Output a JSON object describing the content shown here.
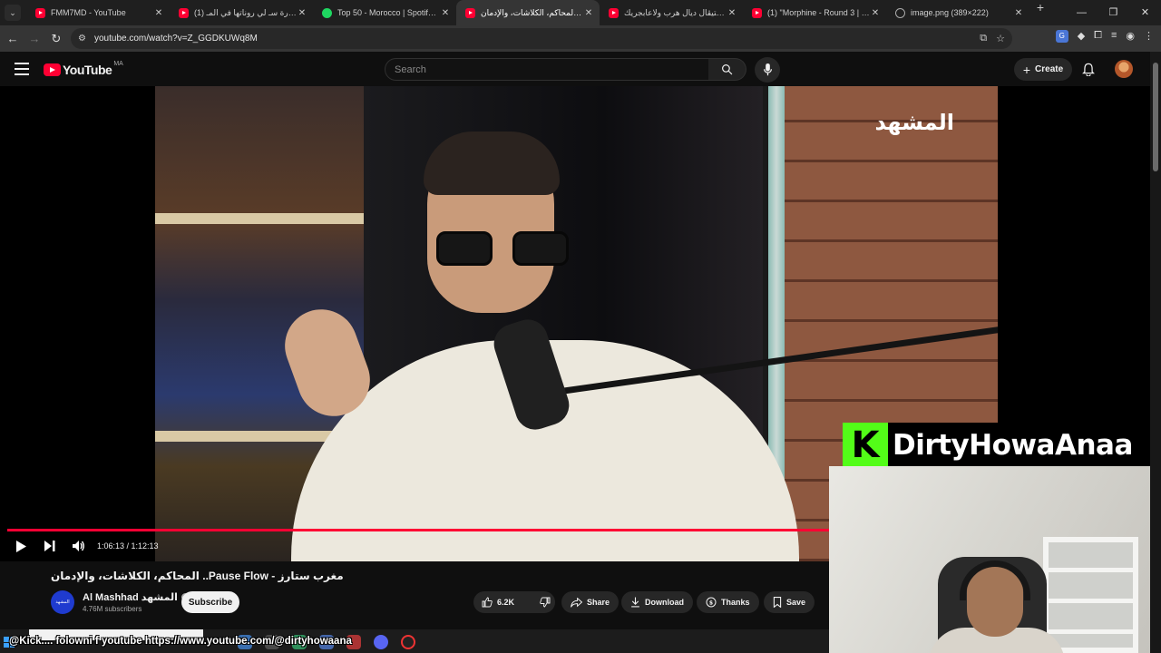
{
  "browser": {
    "tabs": [
      {
        "title": "FMM7MD - YouTube",
        "favicon": "youtube-icon",
        "active": false
      },
      {
        "title": "(1) السيارة سـ لي روناتها في المـ",
        "favicon": "youtube-icon",
        "active": false
      },
      {
        "title": "Top 50 - Morocco | Spotify Play",
        "favicon": "spotify-icon",
        "active": false
      },
      {
        "title": "المحاكم، الكلاشات، والإدمان Flow",
        "favicon": "youtube-icon",
        "active": true
      },
      {
        "title": "فيستيڤال ديال هرب ولاعابجريك",
        "favicon": "youtube-icon",
        "active": false
      },
      {
        "title": "(1) \"Morphine - Round 3 | Figh",
        "favicon": "youtube-icon",
        "active": false
      },
      {
        "title": "image.png (389×222)",
        "favicon": "image-icon",
        "active": false
      }
    ],
    "new_tab": "+",
    "window_controls": {
      "minimize": "—",
      "restore": "❐",
      "close": "✕"
    },
    "url": "youtube.com/watch?v=Z_GGDKUWq8M"
  },
  "youtube": {
    "logo_text": "YouTube",
    "country_code": "MA",
    "search_placeholder": "Search",
    "create_label": "Create",
    "video": {
      "watermark": "المشهد",
      "current_time": "1:06:13",
      "duration": "1:12:13",
      "time_display": "1:06:13 / 1:12:13",
      "progress_fraction": 0.917
    },
    "title": "مغرب ستارز - Pause Flow.. المحاكم، الكلاشات، والإدمان",
    "channel": {
      "name": "Al Mashhad المشهد",
      "avatar_text": "المشهد",
      "subscribers": "4.76M subscribers",
      "subscribe_label": "Subscribe"
    },
    "actions": {
      "likes": "6.2K",
      "share": "Share",
      "download": "Download",
      "thanks": "Thanks",
      "save": "Save"
    }
  },
  "stream_overlay": {
    "kick_letter": "K",
    "streamer_name": "DirtyHowaAnaa",
    "ticker": "@Kick.... folowni f youtube https://www.youtube.com/@dirtyhowaana"
  },
  "colors": {
    "youtube_red": "#ff0033",
    "kick_green": "#53fc18",
    "background": "#0f0f0f"
  }
}
